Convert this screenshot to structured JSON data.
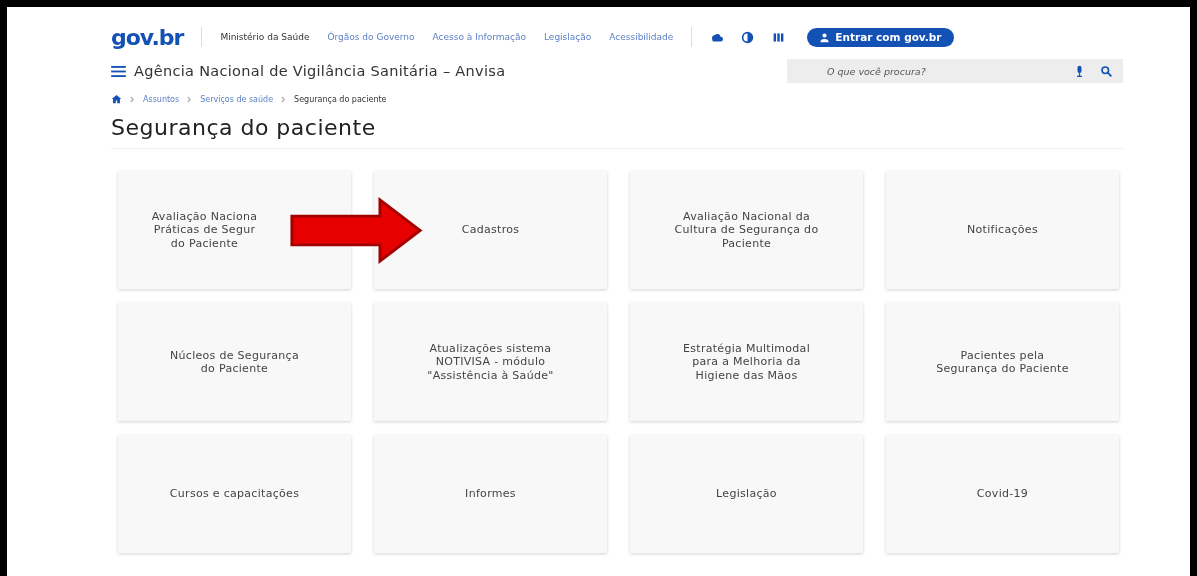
{
  "header": {
    "logo": "gov.br",
    "ministry": "Ministério da Saúde",
    "links": [
      "Órgãos do Governo",
      "Acesso à Informação",
      "Legislação",
      "Acessibilidade"
    ],
    "login_button": "Entrar com gov.br"
  },
  "site": {
    "title": "Agência Nacional de Vigilância Sanitária – Anvisa",
    "search": {
      "placeholder": "O que você procura?"
    }
  },
  "breadcrumb": [
    "Assuntos",
    "Serviços de saúde",
    "Segurança do paciente"
  ],
  "page_title": "Segurança do paciente",
  "cards": [
    {
      "lines": [
        "Avaliação Naciona",
        "Práticas de Segur",
        "do Paciente"
      ],
      "covered": true
    },
    {
      "lines": [
        "Cadastros"
      ],
      "covered": false
    },
    {
      "lines": [
        "Avaliação Nacional da",
        "Cultura de Segurança do",
        "Paciente"
      ],
      "covered": false
    },
    {
      "lines": [
        "Notificações"
      ],
      "covered": false
    },
    {
      "lines": [
        "Núcleos de Segurança",
        "do Paciente"
      ],
      "covered": false
    },
    {
      "lines": [
        "Atualizações sistema",
        "NOTIVISA - módulo",
        "\"Assistência à Saúde\""
      ],
      "covered": false
    },
    {
      "lines": [
        "Estratégia Multimodal",
        "para a Melhoria da",
        "Higiene das Mãos"
      ],
      "covered": false
    },
    {
      "lines": [
        "Pacientes pela",
        "Segurança do Paciente"
      ],
      "covered": false
    },
    {
      "lines": [
        "Cursos e capacitações"
      ],
      "covered": false
    },
    {
      "lines": [
        "Informes"
      ],
      "covered": false
    },
    {
      "lines": [
        "Legislação"
      ],
      "covered": false
    },
    {
      "lines": [
        "Covid-19"
      ],
      "covered": false
    }
  ]
}
